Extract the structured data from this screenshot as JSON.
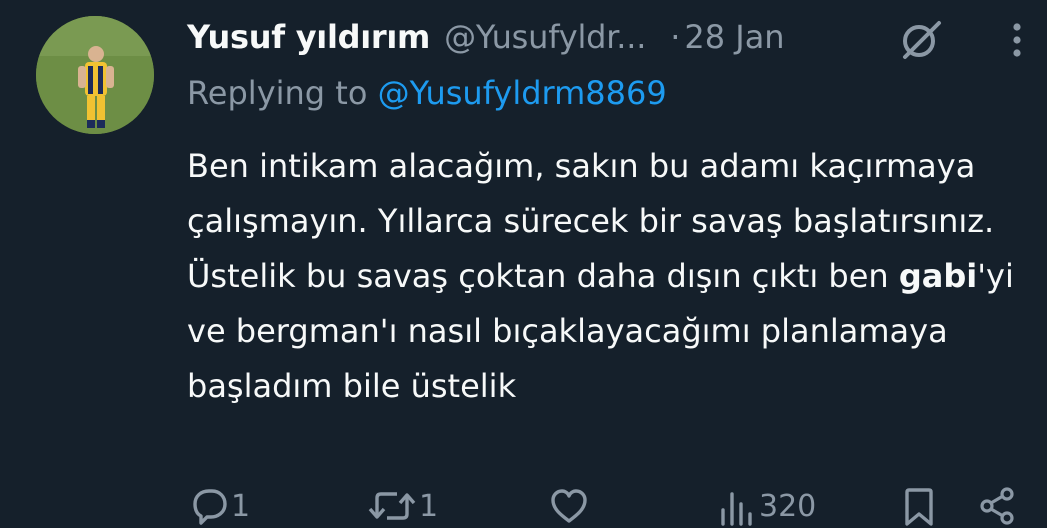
{
  "author": {
    "name": "Yusuf yıldırım",
    "handle": "@Yusufyldr...",
    "separator": "·",
    "date": "28 Jan"
  },
  "reply": {
    "prefix": "Replying to ",
    "mention": "@Yusufyldrm8869"
  },
  "tweet": {
    "text_before": "Ben intikam alacağım, sakın bu adamı kaçırmaya çalışmayın. Yıllarca sürecek bir savaş başlatırsınız. Üstelik bu savaş çoktan daha dışın çıktı ben ",
    "bold_word": "gabi",
    "text_after": "'yi ve bergman'ı nasıl bıçaklayacağımı planlamaya başladım bile üstelik"
  },
  "actions": {
    "replies": "1",
    "retweets": "1",
    "likes": "",
    "views": "320"
  },
  "icons": {
    "grok": "grok-icon",
    "more": "more-vertical-icon",
    "reply": "reply-icon",
    "retweet": "retweet-icon",
    "like": "heart-icon",
    "views": "views-icon",
    "bookmark": "bookmark-icon",
    "share": "share-icon"
  },
  "colors": {
    "background": "#15202b",
    "text": "#f7f9f9",
    "muted": "#8b98a5",
    "link": "#1d9bf0"
  }
}
